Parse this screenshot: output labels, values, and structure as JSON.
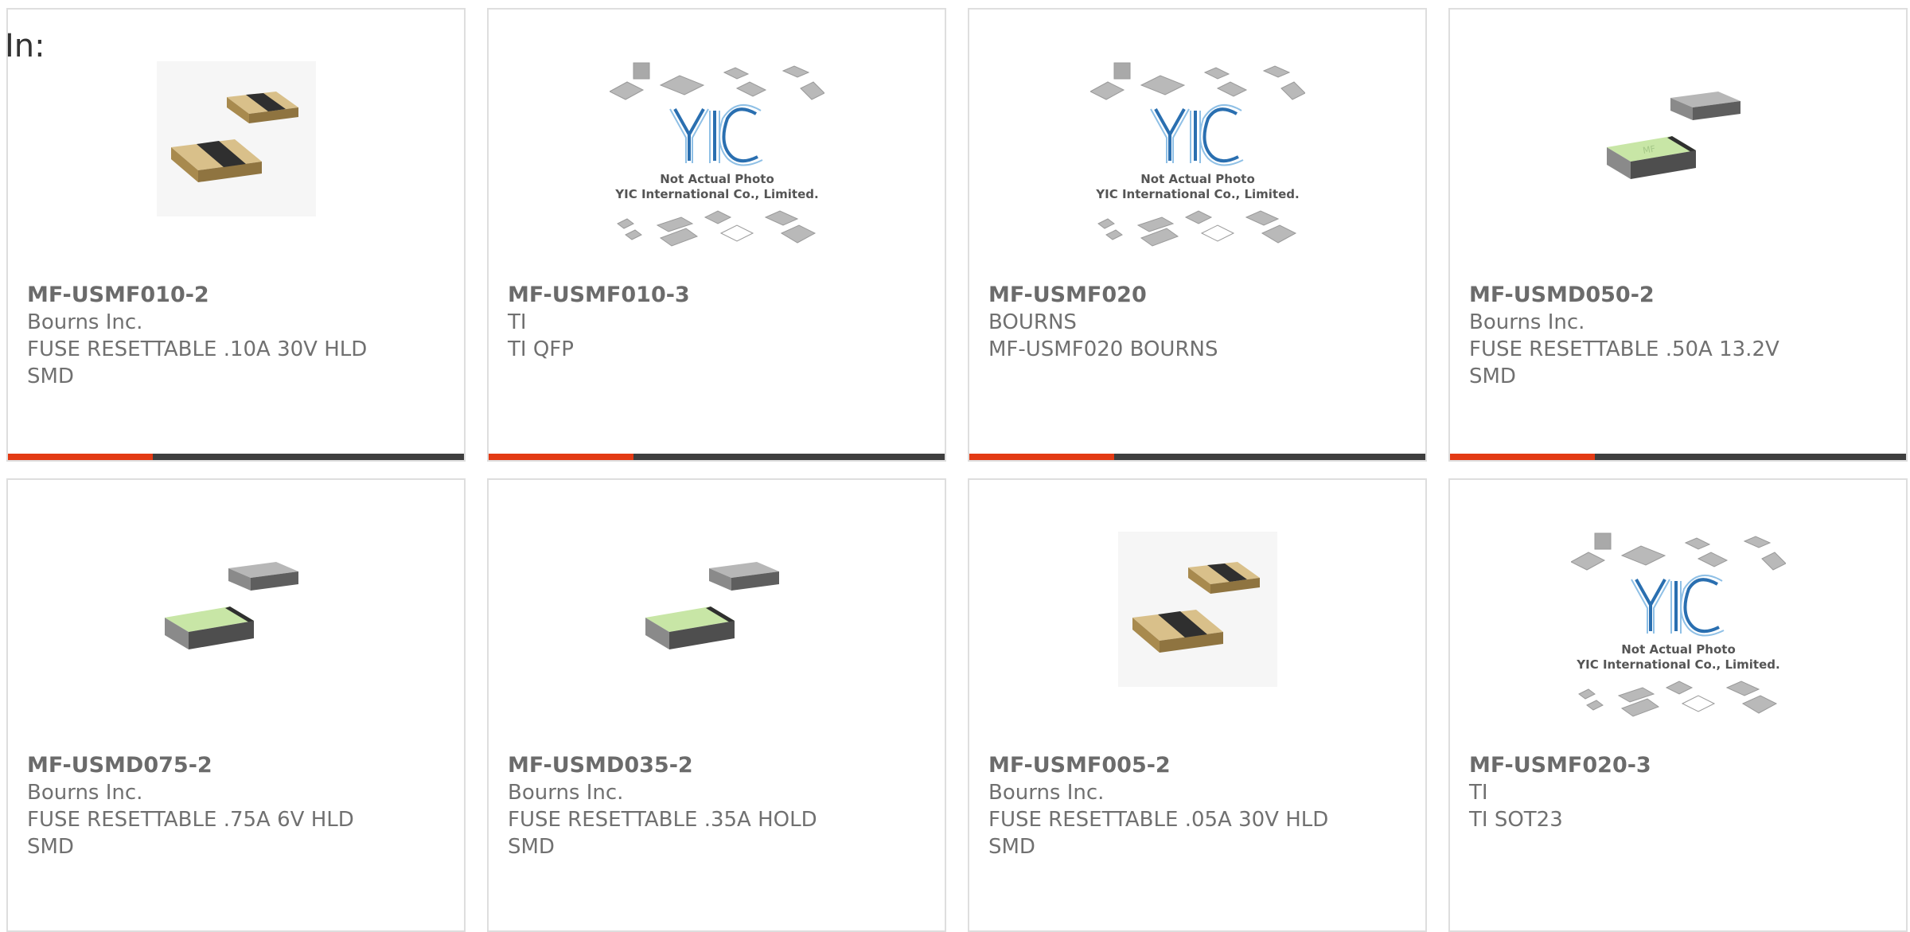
{
  "header": {
    "in_label": "In:"
  },
  "colors": {
    "accent": "#e33a14",
    "bar": "#3e3e3e",
    "border": "#dedede"
  },
  "products": [
    {
      "part": "MF-USMF010-2",
      "maker": "Bourns Inc.",
      "desc1": "FUSE RESETTABLE .10A 30V HLD",
      "desc2": "SMD",
      "image": "fuse-chip-pair"
    },
    {
      "part": "MF-USMF010-3",
      "maker": "TI",
      "desc1": "TI QFP",
      "desc2": "",
      "image": "not-actual-photo",
      "placeholder": {
        "line1": "Not Actual Photo",
        "line2": "YIC International Co., Limited."
      }
    },
    {
      "part": "MF-USMF020",
      "maker": "BOURNS",
      "desc1": "MF-USMF020 BOURNS",
      "desc2": "",
      "image": "not-actual-photo",
      "placeholder": {
        "line1": "Not Actual Photo",
        "line2": "YIC International Co., Limited."
      }
    },
    {
      "part": "MF-USMD050-2",
      "maker": "Bourns Inc.",
      "desc1": "FUSE RESETTABLE .50A 13.2V",
      "desc2": "SMD",
      "image": "smd-chip-green"
    },
    {
      "part": "MF-USMD075-2",
      "maker": "Bourns Inc.",
      "desc1": "FUSE RESETTABLE .75A 6V HLD",
      "desc2": "SMD",
      "image": "smd-chip-green"
    },
    {
      "part": "MF-USMD035-2",
      "maker": "Bourns Inc.",
      "desc1": "FUSE RESETTABLE .35A HOLD",
      "desc2": "SMD",
      "image": "smd-chip-green"
    },
    {
      "part": "MF-USMF005-2",
      "maker": "Bourns Inc.",
      "desc1": "FUSE RESETTABLE .05A 30V HLD",
      "desc2": "SMD",
      "image": "fuse-chip-pair"
    },
    {
      "part": "MF-USMF020-3",
      "maker": "TI",
      "desc1": "TI SOT23",
      "desc2": "",
      "image": "not-actual-photo",
      "placeholder": {
        "line1": "Not Actual Photo",
        "line2": "YIC International Co., Limited."
      }
    }
  ]
}
